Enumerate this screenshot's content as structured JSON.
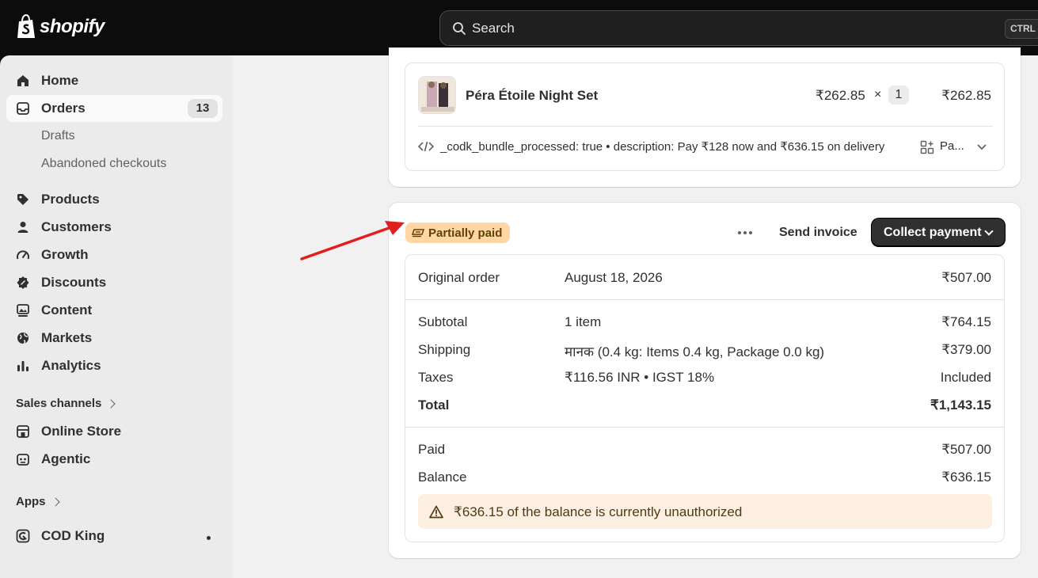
{
  "topbar": {
    "logo_text": "shopify",
    "search_placeholder": "Search",
    "search_shortcut": "CTRL"
  },
  "sidebar": {
    "items": [
      {
        "label": "Home",
        "icon": "home-icon"
      },
      {
        "label": "Orders",
        "icon": "orders-icon",
        "badge": "13",
        "active": true
      },
      {
        "label": "Drafts",
        "sub": true
      },
      {
        "label": "Abandoned checkouts",
        "sub": true
      },
      {
        "label": "Products",
        "icon": "tag-icon"
      },
      {
        "label": "Customers",
        "icon": "person-icon"
      },
      {
        "label": "Growth",
        "icon": "gauge-icon"
      },
      {
        "label": "Discounts",
        "icon": "discount-icon"
      },
      {
        "label": "Content",
        "icon": "content-icon"
      },
      {
        "label": "Markets",
        "icon": "globe-icon"
      },
      {
        "label": "Analytics",
        "icon": "bar-chart-icon"
      }
    ],
    "sales_channels_label": "Sales channels",
    "channels": [
      {
        "label": "Online Store",
        "icon": "store-icon"
      },
      {
        "label": "Agentic",
        "icon": "agentic-icon"
      }
    ],
    "apps_label": "Apps",
    "apps": [
      {
        "label": "COD King",
        "icon": "app-icon"
      }
    ]
  },
  "line_item": {
    "title": "Péra Étoile Night Set",
    "unit_price": "₹262.85",
    "times": "×",
    "quantity": "1",
    "total": "₹262.85",
    "properties": "_codk_bundle_processed: true • description: Pay ₹128 now and ₹636.15 on delivery",
    "extra_truncated": "Pa..."
  },
  "payment": {
    "status_badge": "Partially paid",
    "send_invoice_label": "Send invoice",
    "collect_payment_label": "Collect payment",
    "original_order": {
      "label": "Original order",
      "date": "August 18, 2026",
      "amount": "₹507.00"
    },
    "rows": [
      {
        "label": "Subtotal",
        "detail": "1 item",
        "value": "₹764.15"
      },
      {
        "label": "Shipping",
        "detail": "मानक (0.4 kg: Items 0.4 kg, Package 0.0 kg)",
        "value": "₹379.00"
      },
      {
        "label": "Taxes",
        "detail": "₹116.56 INR • IGST 18%",
        "value": "Included"
      },
      {
        "label": "Total",
        "detail": "",
        "value": "₹1,143.15"
      }
    ],
    "paid": {
      "label": "Paid",
      "value": "₹507.00"
    },
    "balance": {
      "label": "Balance",
      "value": "₹636.15"
    },
    "alert": "₹636.15 of the balance is currently unauthorized"
  },
  "colors": {
    "topbar_bg": "#0c0c0c",
    "status_badge_bg": "#ffd6a4",
    "alert_bg": "#fdf0e3",
    "primary_button_bg": "#303030",
    "annotation_arrow": "#e0201c"
  }
}
